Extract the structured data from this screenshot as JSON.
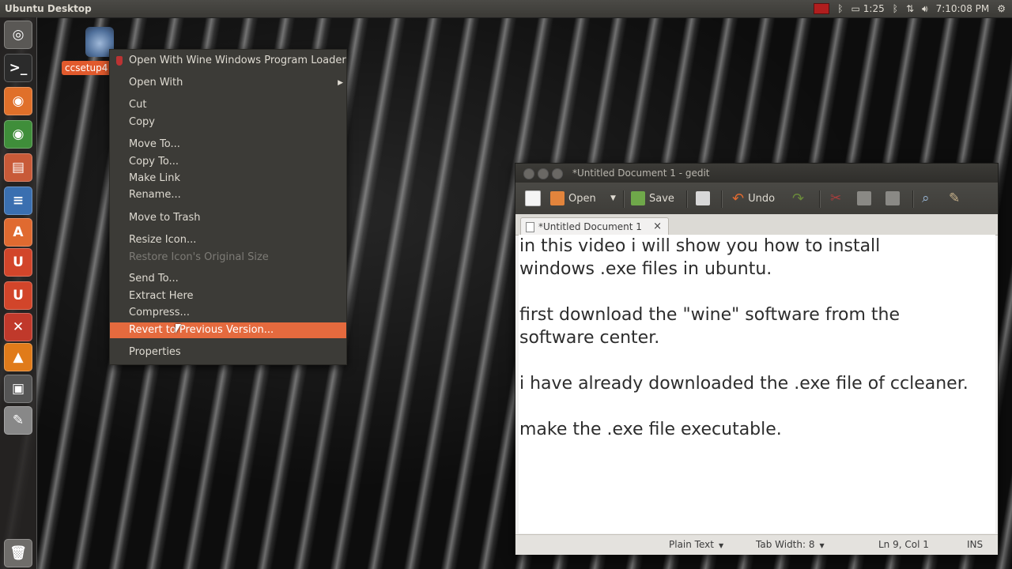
{
  "top_panel": {
    "title": "Ubuntu Desktop",
    "battery": "1:25",
    "clock": "7:10:08 PM",
    "icons": [
      "mail-icon",
      "bluetooth-icon",
      "battery-icon",
      "bluetooth-icon",
      "network-icon",
      "volume-icon",
      "gear-icon"
    ]
  },
  "launcher": {
    "items": [
      {
        "name": "dash-icon",
        "color": "#5a5855",
        "glyph": "◎"
      },
      {
        "name": "terminal-icon",
        "color": "#2b2b2b",
        "glyph": ">_"
      },
      {
        "name": "firefox-icon",
        "color": "#e0702a",
        "glyph": "◉"
      },
      {
        "name": "chrome-icon",
        "color": "#3f8e3a",
        "glyph": "◉"
      },
      {
        "name": "files-icon",
        "color": "#c85a38",
        "glyph": "▤"
      },
      {
        "name": "writer-icon",
        "color": "#3a6fb0",
        "glyph": "≡"
      },
      {
        "name": "software-center-icon",
        "color": "#e06a30",
        "glyph": "A"
      },
      {
        "name": "ubuntu-one-icon",
        "color": "#d2452a",
        "glyph": "U"
      },
      {
        "name": "ubuntu-one-icon-2",
        "color": "#d2452a",
        "glyph": "U"
      },
      {
        "name": "system-settings-icon",
        "color": "#c0392b",
        "glyph": "✕"
      },
      {
        "name": "vlc-icon",
        "color": "#e07b1a",
        "glyph": "▲"
      },
      {
        "name": "screenshot-icon",
        "color": "#555",
        "glyph": "▣"
      },
      {
        "name": "text-editor-icon",
        "color": "#888",
        "glyph": "✎"
      },
      {
        "name": "trash-icon",
        "color": "#6f6d6a",
        "glyph": "🗑"
      }
    ]
  },
  "desktop": {
    "icon_label": "ccsetup4"
  },
  "context_menu": {
    "items": [
      {
        "label": "Open With Wine Windows Program Loader",
        "state": "normal",
        "has_icon": true
      },
      {
        "label": "Open With",
        "state": "normal",
        "submenu": true
      },
      {
        "label": "Cut",
        "state": "normal"
      },
      {
        "label": "Copy",
        "state": "normal"
      },
      {
        "label": "Move To...",
        "state": "normal"
      },
      {
        "label": "Copy To...",
        "state": "normal"
      },
      {
        "label": "Make Link",
        "state": "normal"
      },
      {
        "label": "Rename...",
        "state": "normal"
      },
      {
        "label": "Move to Trash",
        "state": "normal"
      },
      {
        "label": "Resize Icon...",
        "state": "normal"
      },
      {
        "label": "Restore Icon's Original Size",
        "state": "disabled"
      },
      {
        "label": "Send To...",
        "state": "normal"
      },
      {
        "label": "Extract Here",
        "state": "normal"
      },
      {
        "label": "Compress...",
        "state": "normal"
      },
      {
        "label": "Revert to Previous Version...",
        "state": "highlighted"
      },
      {
        "label": "Properties",
        "state": "normal"
      }
    ]
  },
  "gedit": {
    "window_title": "*Untitled Document 1 - gedit",
    "toolbar": {
      "open": "Open",
      "save": "Save",
      "undo": "Undo"
    },
    "tab_label": "*Untitled Document 1",
    "tab_close": "×",
    "lines": [
      "in this video i will show you how to install",
      "windows .exe files in ubuntu.",
      "",
      "first download the \"wine\" software from the",
      "software center.",
      "",
      "i have already downloaded the .exe file of ccleaner.",
      "",
      "make the .exe file executable."
    ],
    "status": {
      "language": "Plain Text",
      "tab_width": "Tab Width:  8",
      "position": "Ln 9, Col 1",
      "mode": "INS"
    }
  }
}
